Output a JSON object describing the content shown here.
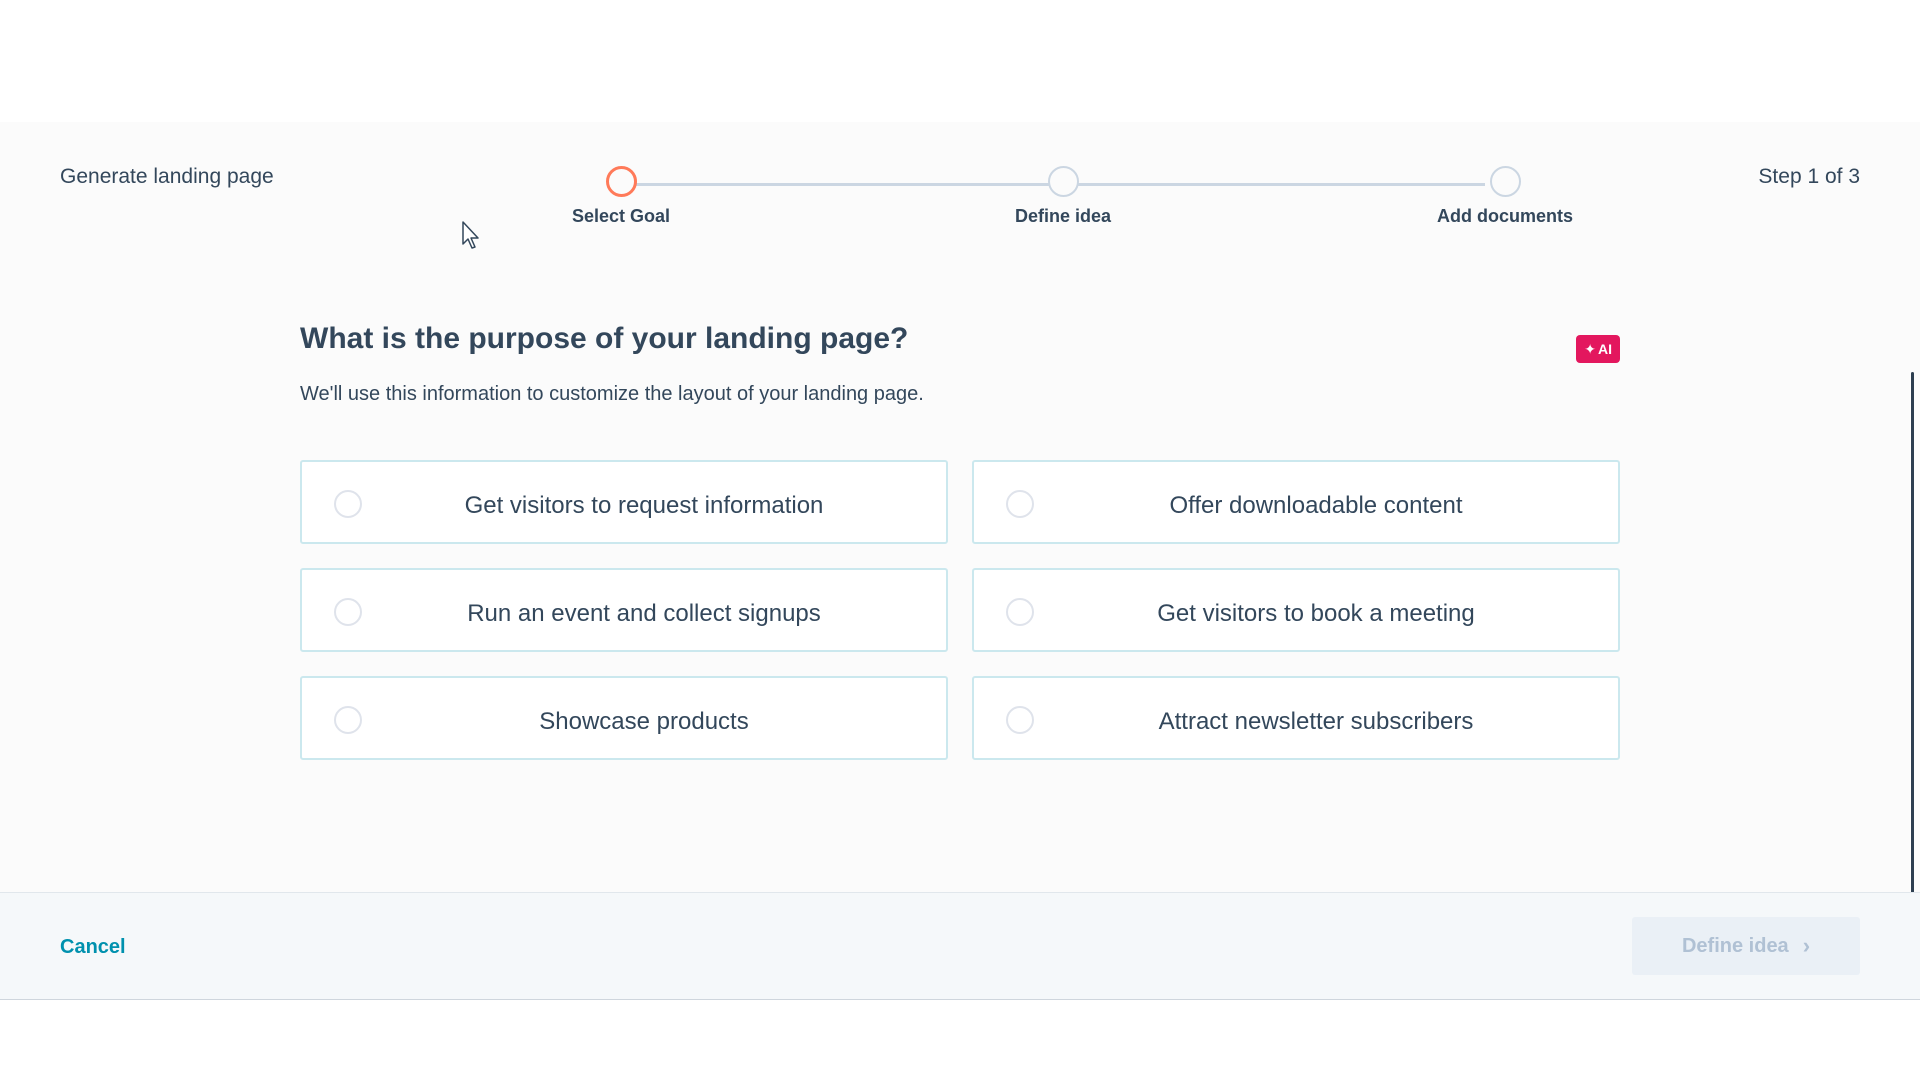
{
  "header": {
    "title": "Generate landing page",
    "step_count": "Step 1 of 3"
  },
  "stepper": {
    "steps": [
      {
        "label": "Select Goal",
        "state": "active"
      },
      {
        "label": "Define idea",
        "state": "pending"
      },
      {
        "label": "Add documents",
        "state": "pending"
      }
    ]
  },
  "main": {
    "question": "What is the purpose of your landing page?",
    "subtitle": "We'll use this information to customize the layout of your landing page.",
    "ai_badge": "AI",
    "options": [
      {
        "label": "Get visitors to request information",
        "selected": false
      },
      {
        "label": "Offer downloadable content",
        "selected": false
      },
      {
        "label": "Run an event and collect signups",
        "selected": false
      },
      {
        "label": "Get visitors to book a meeting",
        "selected": false
      },
      {
        "label": "Showcase products",
        "selected": false
      },
      {
        "label": "Attract newsletter subscribers",
        "selected": false
      }
    ]
  },
  "footer": {
    "cancel_label": "Cancel",
    "next_label": "Define idea",
    "next_disabled": true
  },
  "colors": {
    "accent_step": "#ff7a59",
    "ai_badge": "#e3175e",
    "link": "#0091ae",
    "text": "#33475b"
  },
  "icons": {
    "next_chevron": "chevron-right-icon",
    "ai_spark": "sparkle-icon"
  }
}
